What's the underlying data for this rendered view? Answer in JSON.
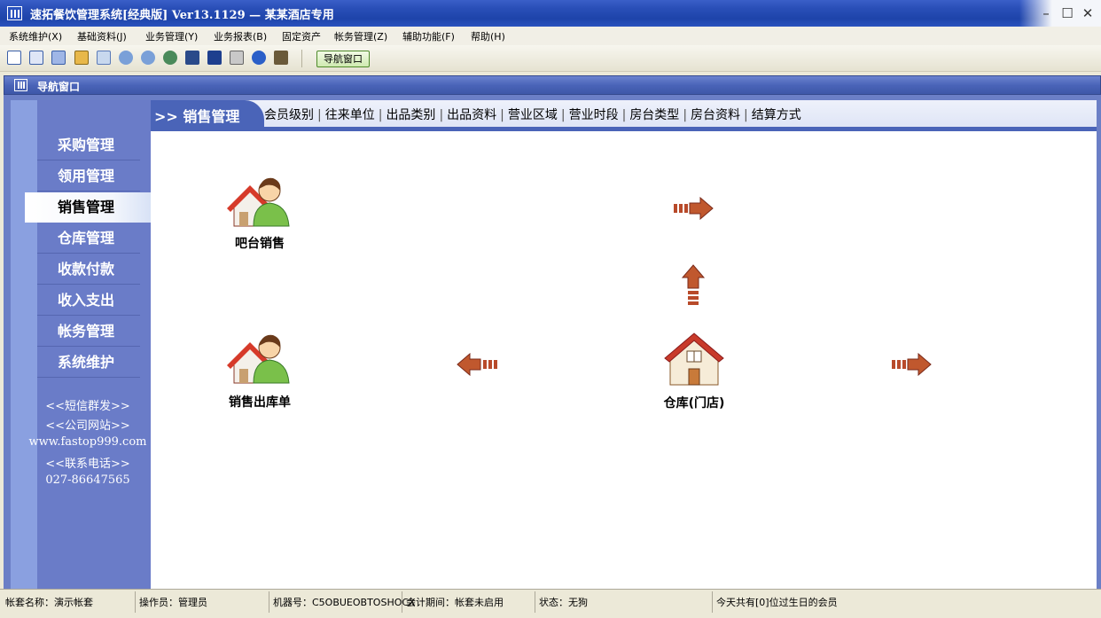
{
  "window": {
    "title": "速拓餐饮管理系统[经典版] Ver13.1129 — 某某酒店专用",
    "minimize": "–",
    "maximize": "☐",
    "close": "✕"
  },
  "menu": [
    {
      "label": "系统维护(X)"
    },
    {
      "label": "基础资料(J)"
    },
    {
      "label": "业务管理(Y)"
    },
    {
      "label": "业务报表(B)"
    },
    {
      "label": "固定资产"
    },
    {
      "label": "帐务管理(Z)"
    },
    {
      "label": "辅助功能(F)"
    },
    {
      "label": "帮助(H)"
    }
  ],
  "toolbar": {
    "nav_button": "导航窗口"
  },
  "nav_window": {
    "title": "导航窗口"
  },
  "sidebar": {
    "items": [
      {
        "label": "采购管理"
      },
      {
        "label": "领用管理"
      },
      {
        "label": "销售管理"
      },
      {
        "label": "仓库管理"
      },
      {
        "label": "收款付款"
      },
      {
        "label": "收入支出"
      },
      {
        "label": "帐务管理"
      },
      {
        "label": "系统维护"
      }
    ],
    "links": {
      "sms": "<<短信群发>>",
      "website": "<<公司网站>>",
      "url": "www.fastop999.com",
      "contact": "<<联系电话>>",
      "phone": "027-86647565"
    }
  },
  "content": {
    "section_title": ">> 销售管理",
    "tab_links": [
      "会员级别",
      "往来单位",
      "出品类别",
      "出品资料",
      "营业区域",
      "营业时段",
      "房台类型",
      "房台资料",
      "结算方式"
    ],
    "nodes": {
      "bar_sales": "吧台销售",
      "sales_outbound": "销售出库单",
      "warehouse": "仓库(门店)"
    }
  },
  "status": {
    "account": "帐套名称：演示帐套",
    "operator": "操作员：管理员",
    "machine": "机器号：C5OBUEOBTOSHOCX",
    "period": "会计期间：帐套未启用",
    "state": "状态：无狗",
    "birthday": "今天共有[0]位过生日的会员"
  },
  "colors": {
    "accent": "#4a64b8",
    "sidebar": "#6a7cc8",
    "arrow": "#b84a2a"
  }
}
